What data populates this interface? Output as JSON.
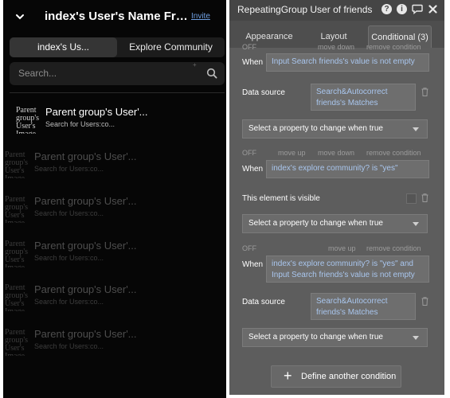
{
  "app": {
    "title": "index's User's Name Frie...",
    "invite": "Invite",
    "tabs": [
      "index's Us...",
      "Explore Community"
    ],
    "search_placeholder": "Search...",
    "rows": [
      {
        "avatar": "Parent group's User's Image",
        "name": "Parent group's User'...",
        "sub": "Search for Users:co..."
      },
      {
        "avatar": "Parent group's User's Image",
        "name": "Parent group's User'...",
        "sub": "Search for Users:co..."
      },
      {
        "avatar": "Parent group's User's Image",
        "name": "Parent group's User'...",
        "sub": "Search for Users:co..."
      },
      {
        "avatar": "Parent group's User's Image",
        "name": "Parent group's User'...",
        "sub": "Search for Users:co..."
      },
      {
        "avatar": "Parent group's User's Image",
        "name": "Parent group's User'...",
        "sub": "Search for Users:co..."
      },
      {
        "avatar": "Parent group's User's Image",
        "name": "Parent group's User'...",
        "sub": "Search for Users:co..."
      }
    ]
  },
  "panel": {
    "title": "RepeatingGroup User of friends",
    "icons": [
      "help-icon",
      "info-icon",
      "comment-icon",
      "close-icon"
    ],
    "tabs": {
      "appearance": "Appearance",
      "layout": "Layout",
      "conditional": "Conditional (3)"
    },
    "conditions": [
      {
        "off": "OFF",
        "move_up": "move up",
        "move_down": "move down",
        "remove": "remove condition",
        "when_label": "When",
        "when": "Input Search friends's value is not empty",
        "prop_label": "Data source",
        "prop_value": "Search&Autocorrect friends's Matches",
        "select": "Select a property to change when true"
      },
      {
        "off": "OFF",
        "move_up": "move up",
        "move_down": "move down",
        "remove": "remove condition",
        "when_label": "When",
        "when": "index's explore community? is \"yes\"",
        "prop_label": "This element is visible",
        "select": "Select a property to change when true"
      },
      {
        "off": "OFF",
        "move_up": "move up",
        "remove": "remove condition",
        "when_label": "When",
        "when": "index's explore community? is \"yes\" and Input Search friends's value is not empty",
        "prop_label": "Data source",
        "prop_value": "Search&Autocorrect friends's Matches",
        "select": "Select a property to change when true"
      }
    ],
    "add_condition": "Define another condition"
  },
  "colors": {
    "accent_text": "#a9c6ee",
    "invite_link": "#6f9fe0",
    "panel_bg": "#5d5d5d",
    "app_bg": "#060606"
  }
}
